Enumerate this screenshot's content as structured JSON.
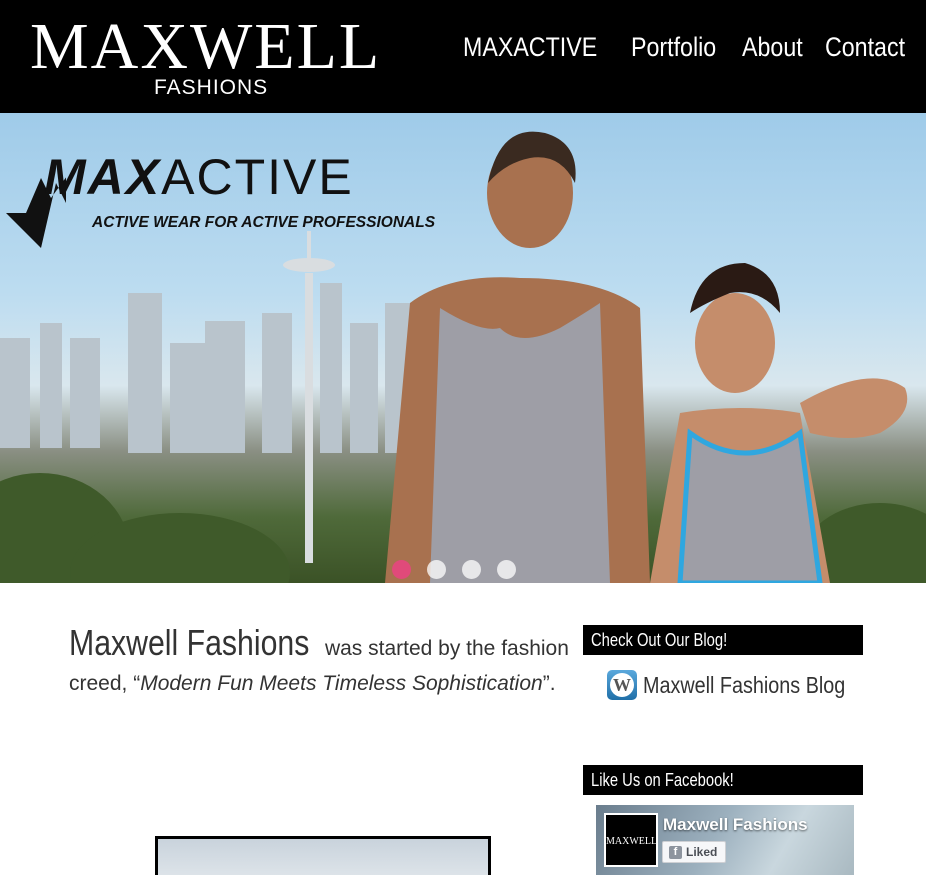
{
  "header": {
    "logo_main": "MAXWELL",
    "logo_sub": "FASHIONS",
    "nav": [
      "MAXACTIVE",
      "Portfolio",
      "About",
      "Contact"
    ]
  },
  "hero": {
    "brand_bold": "MAX",
    "brand_rest": "ACTIVE",
    "tagline": "ACTIVE WEAR FOR ACTIVE PROFESSIONALS",
    "slides_total": 4,
    "active_slide": 1
  },
  "intro": {
    "brand_name": "Maxwell Fashions",
    "text_before": " was started by the fashion creed, “",
    "quote": "Modern Fun Meets Timeless Sophistication",
    "text_after": "”."
  },
  "sidebar": {
    "blog_title": "Check Out Our Blog!",
    "blog_link": "Maxwell Fashions Blog",
    "facebook_title": "Like Us on Facebook!",
    "facebook_page_name": "Maxwell Fashions",
    "facebook_liked_label": "Liked",
    "facebook_thumb_text": "MAXWELL"
  },
  "colors": {
    "header_bg": "#000000",
    "dot_active": "#e04a7a",
    "text": "#333333"
  }
}
